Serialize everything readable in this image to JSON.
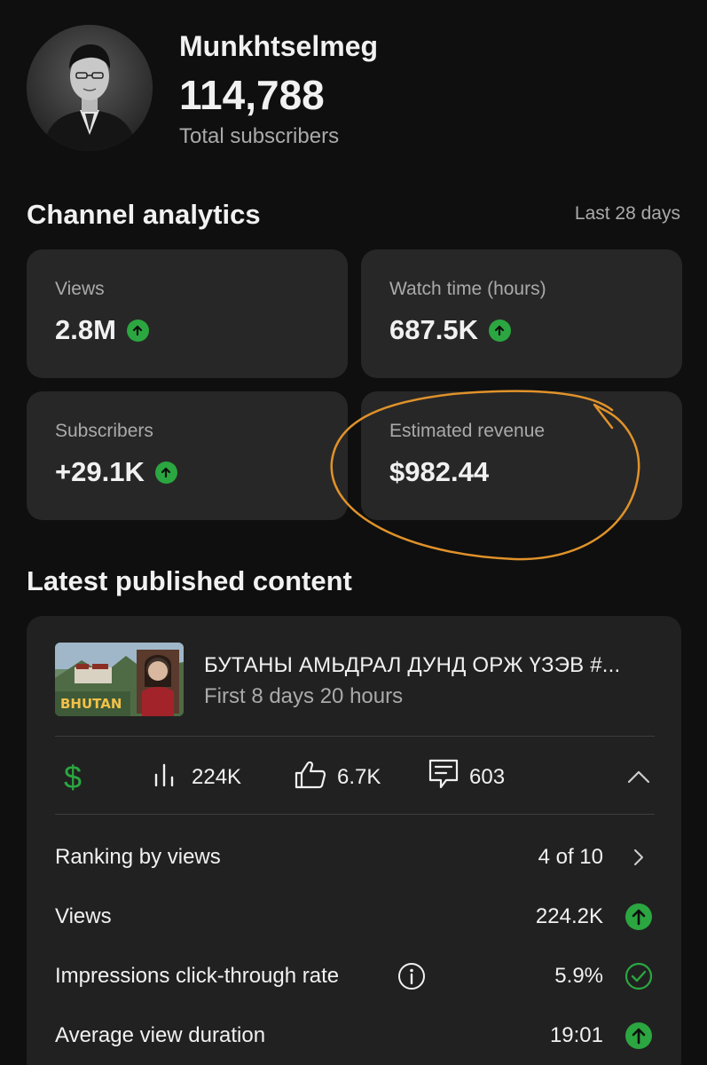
{
  "channel": {
    "name": "Munkhtselmeg",
    "subscribers": "114,788",
    "subscribers_label": "Total subscribers"
  },
  "analytics": {
    "title": "Channel analytics",
    "period": "Last 28 days",
    "cards": [
      {
        "label": "Views",
        "value": "2.8M",
        "trend": "up"
      },
      {
        "label": "Watch time (hours)",
        "value": "687.5K",
        "trend": "up"
      },
      {
        "label": "Subscribers",
        "value": "+29.1K",
        "trend": "up"
      },
      {
        "label": "Estimated revenue",
        "value": "$982.44",
        "trend": "none"
      }
    ]
  },
  "latest": {
    "title": "Latest published content",
    "video": {
      "title": "БУТАНЫ АМЬДРАЛ ДУНД ОРЖ ҮЗЭВ #...",
      "subtitle": "First 8 days 20 hours",
      "thumbnail_text": "BHUTAN"
    },
    "stats": {
      "views": "224K",
      "likes": "6.7K",
      "comments": "603"
    },
    "rows": [
      {
        "label": "Ranking by views",
        "value": "4 of 10",
        "icon": "chevron-right-icon"
      },
      {
        "label": "Views",
        "value": "224.2K",
        "icon": "arrow-up-icon"
      },
      {
        "label": "Impressions click-through rate",
        "value": "5.9%",
        "icon": "check-circle-icon"
      },
      {
        "label": "Average view duration",
        "value": "19:01",
        "icon": "arrow-up-icon"
      }
    ]
  },
  "colors": {
    "background": "#0f0f0f",
    "card": "#272727",
    "positive": "#2ba640",
    "annotation": "#e0922a"
  }
}
